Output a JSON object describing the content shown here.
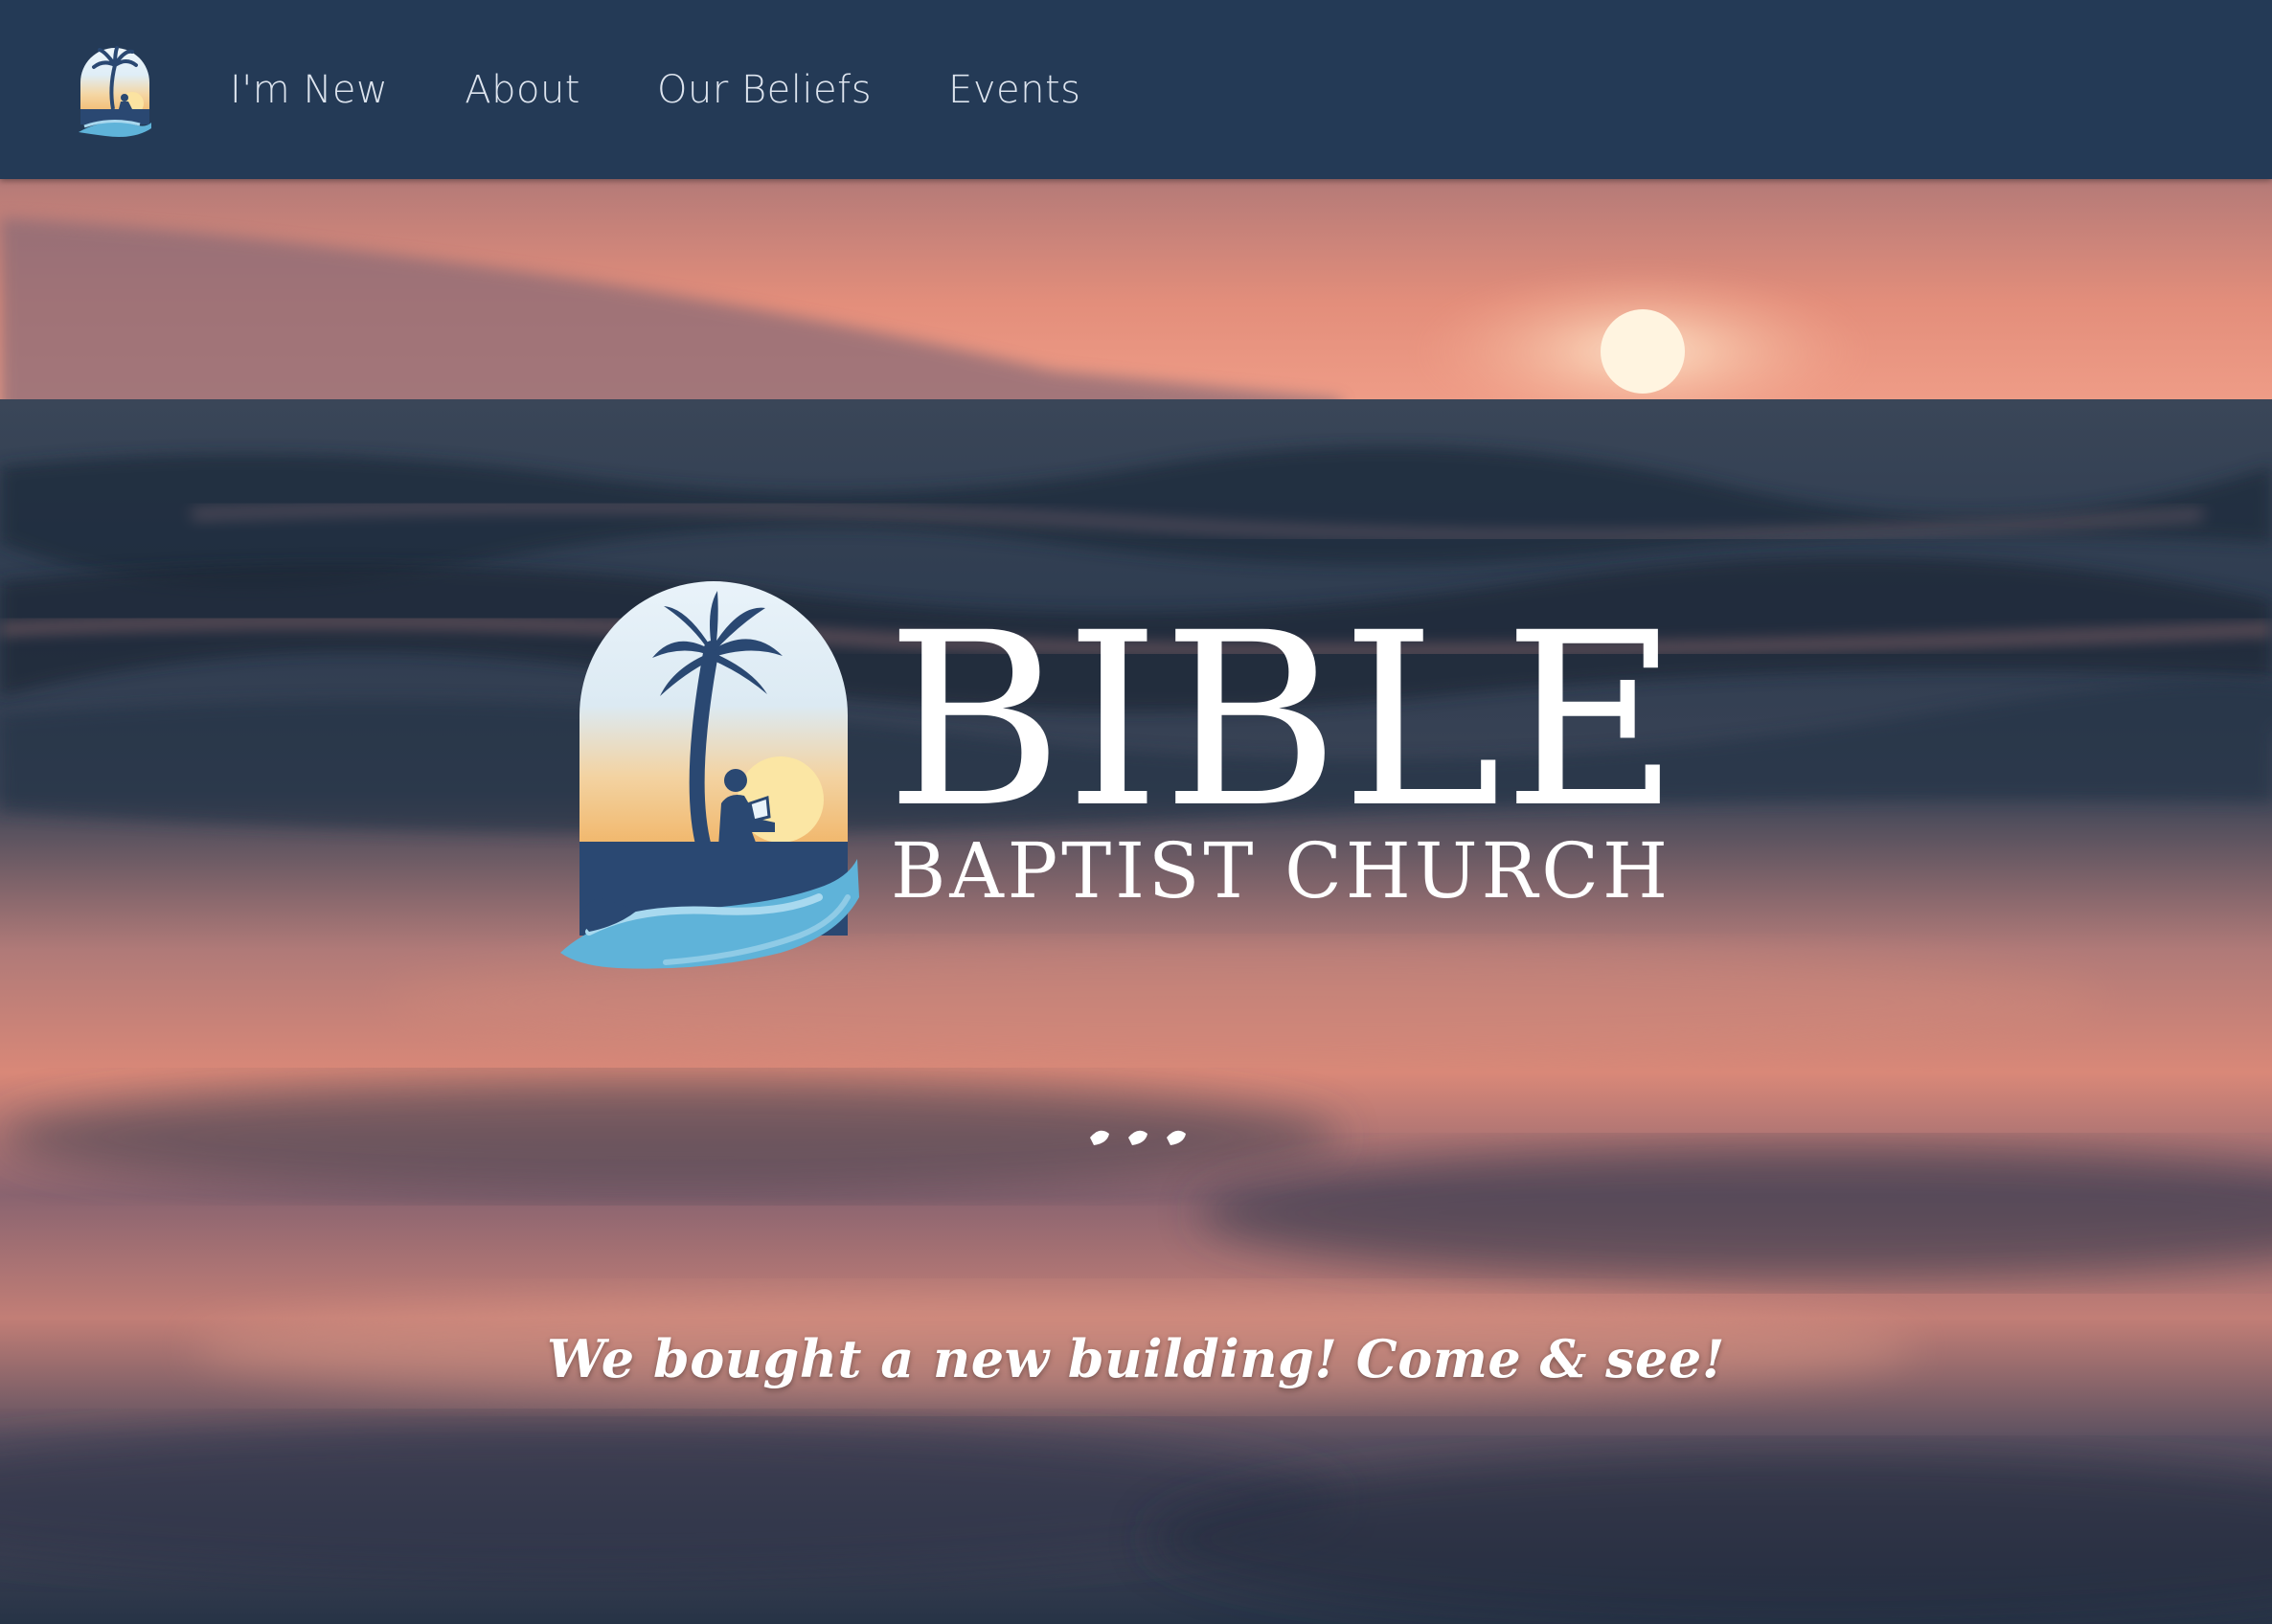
{
  "nav": {
    "logo_icon": "church-logo-icon",
    "items": [
      {
        "label": "I'm New"
      },
      {
        "label": "About"
      },
      {
        "label": "Our Beliefs"
      },
      {
        "label": "Events"
      }
    ]
  },
  "hero": {
    "brand_title": "BIBLE",
    "brand_subtitle": "BAPTIST CHURCH",
    "dots_icon": "ellipsis-icon",
    "tagline": "We bought a new building! Come & see!"
  },
  "colors": {
    "nav_bg": "#243a56",
    "nav_text": "#dde4ee",
    "brand_text": "#ffffff",
    "logo_navy": "#2a4872",
    "logo_wave": "#5fb3d9",
    "logo_sun": "#f7d98a"
  }
}
